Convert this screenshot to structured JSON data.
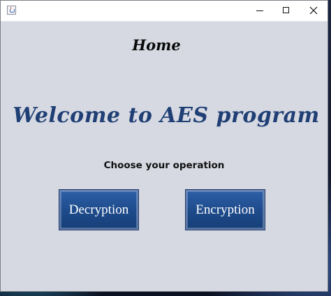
{
  "window": {
    "title": "",
    "controls": {
      "minimize_icon": "minimize-icon",
      "maximize_icon": "maximize-icon",
      "close_icon": "close-icon"
    }
  },
  "main": {
    "home_heading": "Home",
    "welcome_text": "Welcome to AES program",
    "prompt": "Choose your operation",
    "buttons": {
      "decryption": "Decryption",
      "encryption": "Encryption"
    }
  },
  "colors": {
    "window_bg": "#d6d9e1",
    "heading_blue": "#1f3f75",
    "button_blue": "#1d4a8a"
  }
}
